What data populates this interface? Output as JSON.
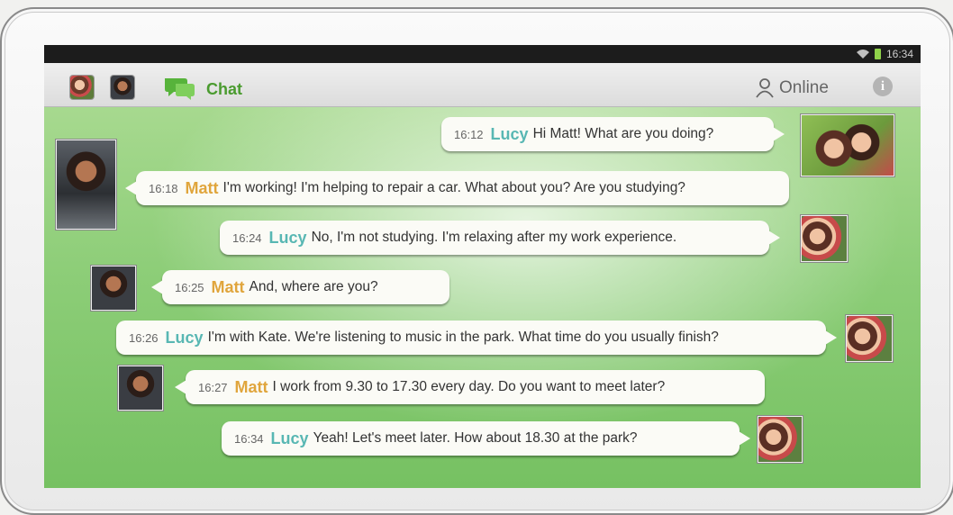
{
  "status_bar": {
    "time": "16:34"
  },
  "toolbar": {
    "title": "Chat",
    "status_label": "Online"
  },
  "messages": [
    {
      "time": "16:12",
      "sender": "Lucy",
      "text": "Hi Matt! What are you doing?"
    },
    {
      "time": "16:18",
      "sender": "Matt",
      "text": "I'm working! I'm helping to repair a car. What about you? Are you studying?"
    },
    {
      "time": "16:24",
      "sender": "Lucy",
      "text": "No, I'm not studying. I'm relaxing after my work experience."
    },
    {
      "time": "16:25",
      "sender": "Matt",
      "text": "And, where are you?"
    },
    {
      "time": "16:26",
      "sender": "Lucy",
      "text": "I'm with Kate. We're listening to music in the park. What time do you usually finish?"
    },
    {
      "time": "16:27",
      "sender": "Matt",
      "text": "I work from 9.30 to 17.30 every day. Do you want to meet later?"
    },
    {
      "time": "16:34",
      "sender": "Lucy",
      "text": "Yeah! Let's meet later. How about 18.30 at the park?"
    }
  ],
  "colors": {
    "lucy_name": "#58b7b3",
    "matt_name": "#e0a53c",
    "chat_title": "#4a9b2f",
    "chat_bg": "#8ccd77"
  },
  "icons": [
    "wifi-icon",
    "battery-icon",
    "chat-icon",
    "person-icon",
    "info-icon"
  ]
}
